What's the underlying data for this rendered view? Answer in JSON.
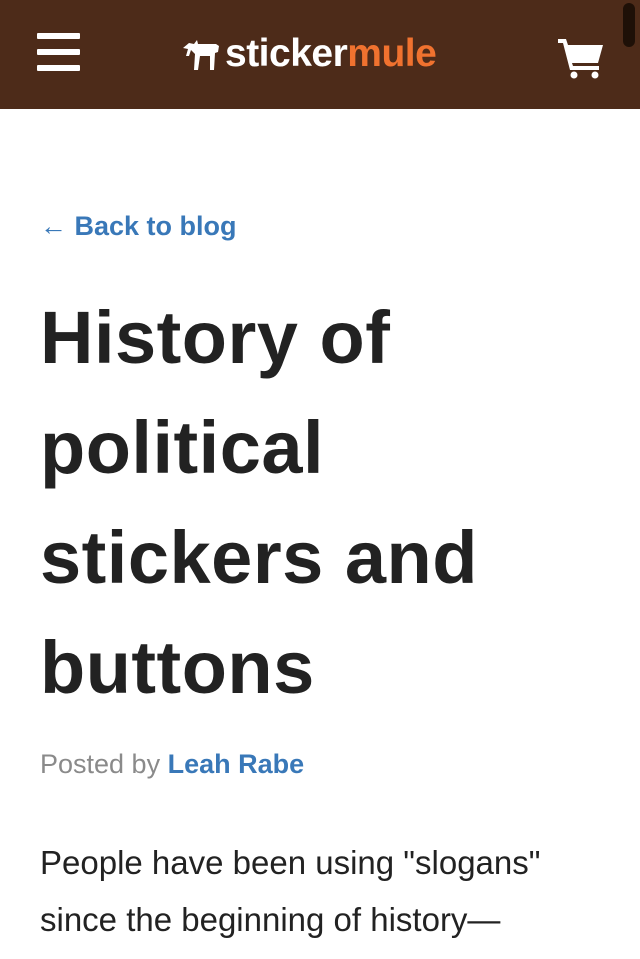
{
  "header": {
    "logo_word1": "sticker",
    "logo_word2": "mule",
    "menu_icon": "hamburger-menu-icon",
    "cart_icon": "shopping-cart-icon",
    "brand_colors": {
      "bar": "#4d2b19",
      "accent": "#f0722f",
      "link": "#3978b8"
    }
  },
  "article": {
    "back_link": "← Back to blog",
    "title": "History of political stickers and buttons",
    "posted_prefix": "Posted by ",
    "author": "Leah Rabe",
    "intro": "People have been using \"slogans\" since the beginning of history—"
  }
}
